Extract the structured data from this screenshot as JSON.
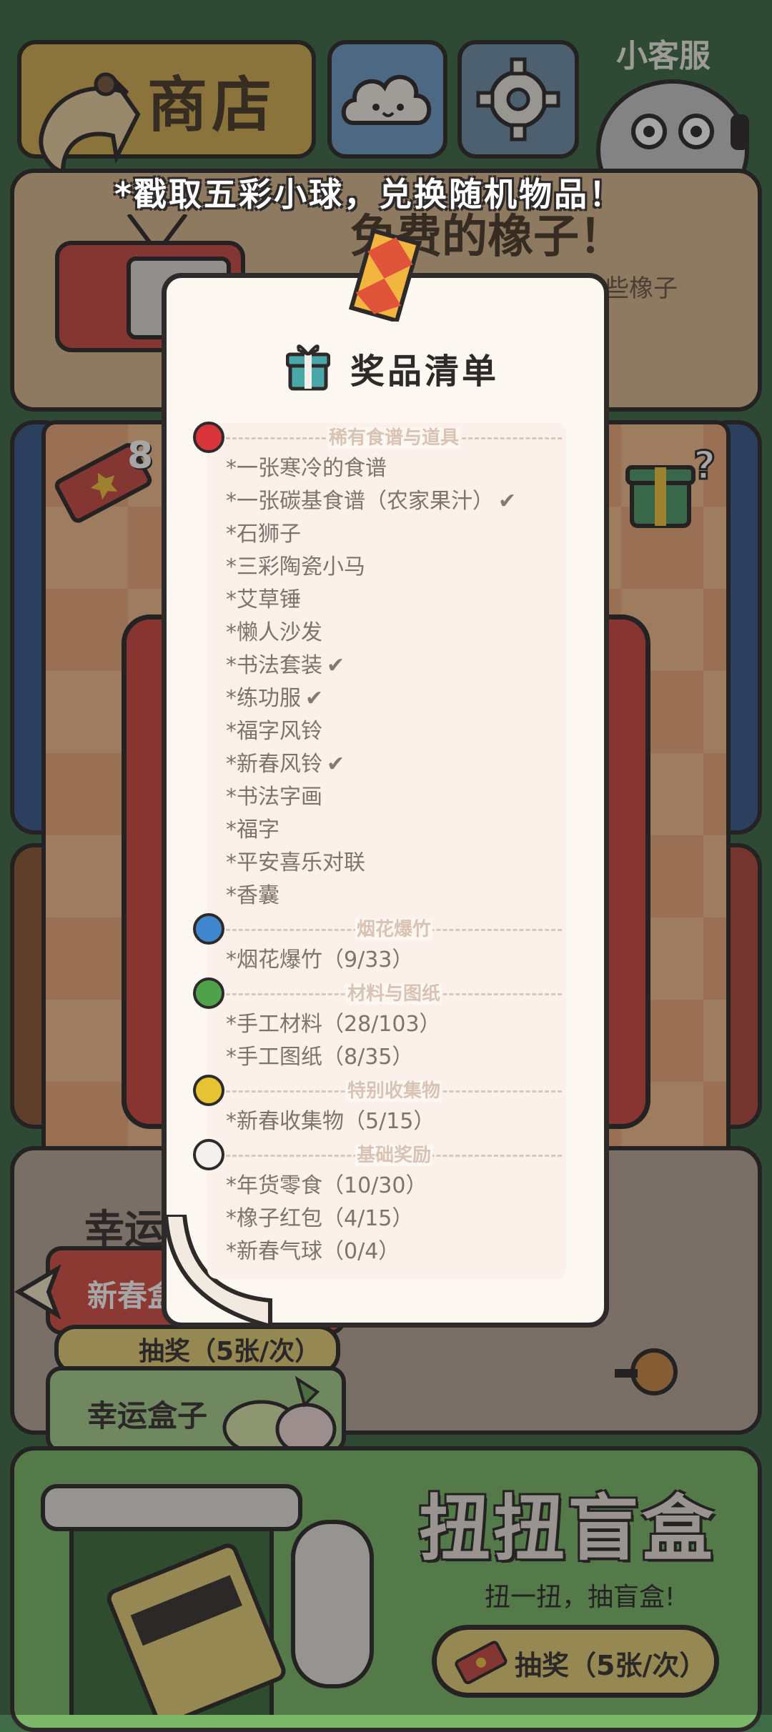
{
  "header": {
    "shop_label": "商店",
    "customer_service_label": "小客服"
  },
  "banner": {
    "tip": "*戳取五彩小球，兑换随机物品！",
    "free_acorn_title": "免费的橡子！",
    "free_acorn_sub": "些橡子"
  },
  "ticket_count": "8",
  "lucky_section": {
    "title_partial": "幸运",
    "newyear_box_label": "新春盒",
    "draw_small_label": "抽奖（5张/次）",
    "lucky_box_label": "幸运盒子"
  },
  "blind_box": {
    "title": "扭扭盲盒",
    "subtitle": "扭一扭，抽盲盒!",
    "draw_label": "抽奖（5张/次）"
  },
  "modal": {
    "title": "奖品清单",
    "categories": [
      {
        "label": "稀有食谱与道具",
        "color": "#d9343b",
        "items": [
          {
            "text": "*一张寒冷的食谱",
            "checked": false
          },
          {
            "text": "*一张碳基食谱（农家果汁）",
            "checked": true
          },
          {
            "text": "*石狮子",
            "checked": false
          },
          {
            "text": "*三彩陶瓷小马",
            "checked": false
          },
          {
            "text": "*艾草锤",
            "checked": false
          },
          {
            "text": "*懒人沙发",
            "checked": false
          },
          {
            "text": "*书法套装",
            "checked": true
          },
          {
            "text": "*练功服",
            "checked": true
          },
          {
            "text": "*福字风铃",
            "checked": false
          },
          {
            "text": "*新春风铃",
            "checked": true
          },
          {
            "text": "*书法字画",
            "checked": false
          },
          {
            "text": "*福字",
            "checked": false
          },
          {
            "text": "*平安喜乐对联",
            "checked": false
          },
          {
            "text": "*香囊",
            "checked": false
          }
        ]
      },
      {
        "label": "烟花爆竹",
        "color": "#3f86cf",
        "items": [
          {
            "text": "*烟花爆竹（9/33）",
            "checked": false
          }
        ]
      },
      {
        "label": "材料与图纸",
        "color": "#4ea24a",
        "items": [
          {
            "text": "*手工材料（28/103）",
            "checked": false
          },
          {
            "text": "*手工图纸（8/35）",
            "checked": false
          }
        ]
      },
      {
        "label": "特别收集物",
        "color": "#e6c332",
        "items": [
          {
            "text": "*新春收集物（5/15）",
            "checked": false
          }
        ]
      },
      {
        "label": "基础奖励",
        "color": "#f3f0ee",
        "items": [
          {
            "text": "*年货零食（10/30）",
            "checked": false
          },
          {
            "text": "*橡子红包（4/15）",
            "checked": false
          },
          {
            "text": "*新春气球（0/4）",
            "checked": false
          }
        ]
      }
    ]
  }
}
